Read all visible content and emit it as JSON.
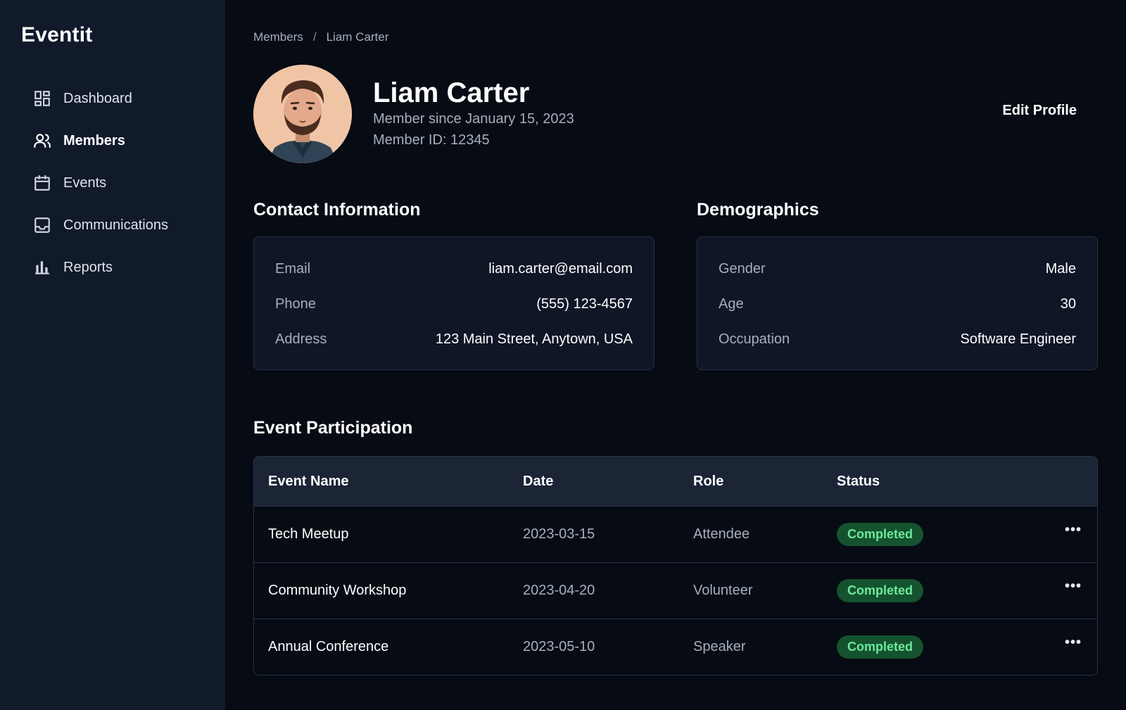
{
  "app": {
    "brand": "Eventit"
  },
  "sidebar": {
    "items": [
      {
        "label": "Dashboard",
        "icon": "dashboard-icon",
        "active": false
      },
      {
        "label": "Members",
        "icon": "users-icon",
        "active": true
      },
      {
        "label": "Events",
        "icon": "calendar-icon",
        "active": false
      },
      {
        "label": "Communications",
        "icon": "inbox-icon",
        "active": false
      },
      {
        "label": "Reports",
        "icon": "bar-chart-icon",
        "active": false
      }
    ]
  },
  "breadcrumb": {
    "parent": "Members",
    "separator": "/",
    "current": "Liam Carter"
  },
  "profile": {
    "name": "Liam Carter",
    "member_since": "Member since January 15, 2023",
    "member_id": "Member ID: 12345",
    "edit_label": "Edit Profile"
  },
  "contact": {
    "title": "Contact Information",
    "rows": [
      {
        "label": "Email",
        "value": "liam.carter@email.com"
      },
      {
        "label": "Phone",
        "value": "(555) 123-4567"
      },
      {
        "label": "Address",
        "value": "123 Main Street, Anytown, USA"
      }
    ]
  },
  "demographics": {
    "title": "Demographics",
    "rows": [
      {
        "label": "Gender",
        "value": "Male"
      },
      {
        "label": "Age",
        "value": "30"
      },
      {
        "label": "Occupation",
        "value": "Software Engineer"
      }
    ]
  },
  "events": {
    "title": "Event Participation",
    "columns": [
      "Event Name",
      "Date",
      "Role",
      "Status"
    ],
    "rows": [
      {
        "name": "Tech Meetup",
        "date": "2023-03-15",
        "role": "Attendee",
        "status": "Completed",
        "more": "•••"
      },
      {
        "name": "Community Workshop",
        "date": "2023-04-20",
        "role": "Volunteer",
        "status": "Completed",
        "more": "•••"
      },
      {
        "name": "Annual Conference",
        "date": "2023-05-10",
        "role": "Speaker",
        "status": "Completed",
        "more": "•••"
      }
    ]
  },
  "colors": {
    "sidebar_bg": "#111a2b",
    "page_bg": "#060b14",
    "card_bg": "#0f1626",
    "table_header_bg": "#1c2536",
    "badge_bg": "#14532d",
    "badge_text": "#6ee7a0"
  }
}
